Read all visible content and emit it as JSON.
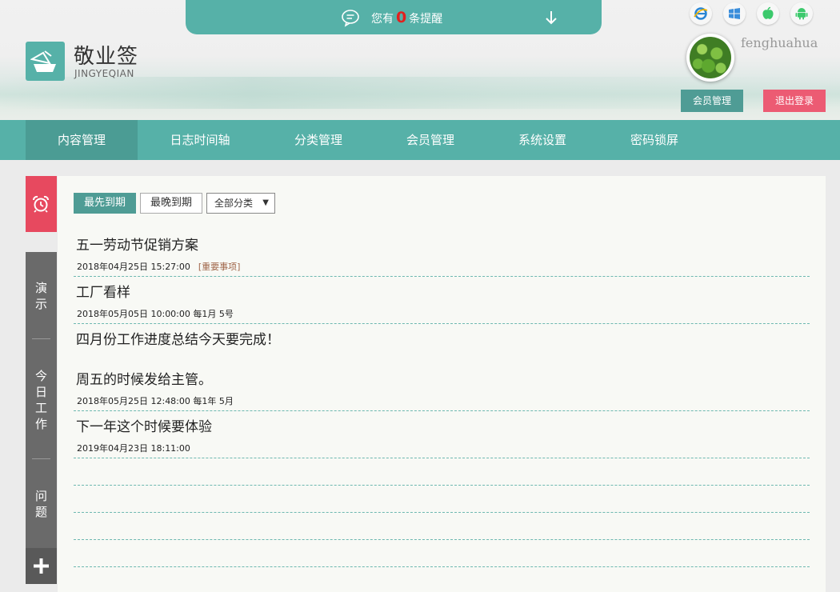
{
  "notice": {
    "prefix": "您有",
    "count": "0",
    "suffix": "条提醒"
  },
  "brand": {
    "title": "敬业签",
    "subtitle": "JINGYEQIAN"
  },
  "platforms": [
    "ie-icon",
    "windows-icon",
    "apple-icon",
    "android-icon"
  ],
  "user": {
    "name": "fenghuahua",
    "member_btn": "会员管理",
    "logout_btn": "退出登录"
  },
  "nav": [
    "内容管理",
    "日志时间轴",
    "分类管理",
    "会员管理",
    "系统设置",
    "密码锁屏"
  ],
  "sidebar": {
    "tabs": [
      "演示",
      "今日工作",
      "问题"
    ]
  },
  "toolbar": {
    "sort_first": "最先到期",
    "sort_last": "最晚到期",
    "category": "全部分类"
  },
  "entries": [
    {
      "title": "五一劳动节促销方案",
      "meta": "2018年04月25日 15:27:00",
      "tag": "[重要事项]"
    },
    {
      "title": "工厂看样",
      "meta": "2018年05月05日 10:00:00 每1月 5号",
      "tag": ""
    },
    {
      "title": "四月份工作进度总结今天要完成！",
      "title2": "周五的时候发给主管。",
      "meta": "2018年05月25日 12:48:00 每1年 5月",
      "tag": ""
    },
    {
      "title": "下一年这个时候要体验",
      "meta": "2019年04月23日 18:11:00",
      "tag": ""
    }
  ],
  "colors": {
    "accent": "#56b1a8",
    "danger": "#ec5b73",
    "count": "#e2201e"
  }
}
